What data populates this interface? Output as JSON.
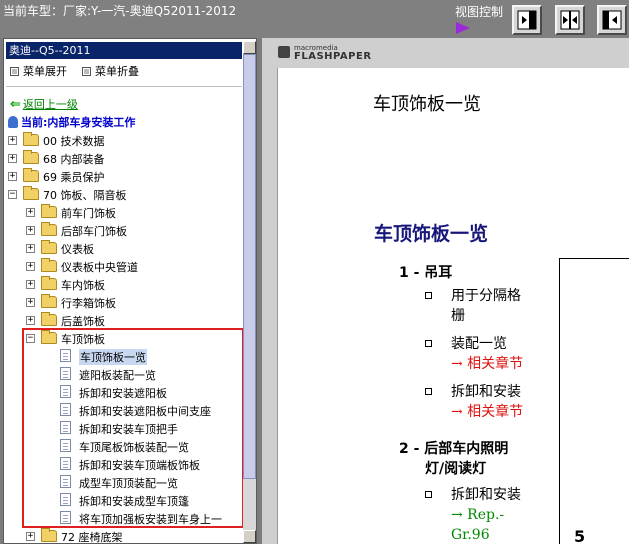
{
  "header": {
    "car_info": "当前车型：厂家:Y-一汽-奥迪Q52011-2012",
    "view_control": "视图控制"
  },
  "tree": {
    "title": "奥迪--Q5--2011",
    "menu_expand": "菜单展开",
    "menu_collapse": "菜单折叠",
    "back_link": "返回上一级",
    "current": "当前:内部车身安装工作",
    "items": [
      {
        "label": "00 技术数据",
        "type": "folder",
        "toggle": "+"
      },
      {
        "label": "68 内部装备",
        "type": "folder",
        "toggle": "+"
      },
      {
        "label": "69 乘员保护",
        "type": "folder",
        "toggle": "+"
      },
      {
        "label": "70 饰板、隔音板",
        "type": "folder",
        "toggle": "-"
      },
      {
        "label": "前车门饰板",
        "type": "folder",
        "toggle": "+"
      },
      {
        "label": "后部车门饰板",
        "type": "folder",
        "toggle": "+"
      },
      {
        "label": "仪表板",
        "type": "folder",
        "toggle": "+"
      },
      {
        "label": "仪表板中央管道",
        "type": "folder",
        "toggle": "+"
      },
      {
        "label": "车内饰板",
        "type": "folder",
        "toggle": "+"
      },
      {
        "label": "行李箱饰板",
        "type": "folder",
        "toggle": "+"
      },
      {
        "label": "后盖饰板",
        "type": "folder",
        "toggle": "+"
      },
      {
        "label": "车顶饰板",
        "type": "folder",
        "toggle": "-"
      },
      {
        "label": "车顶饰板一览",
        "type": "doc",
        "selected": true
      },
      {
        "label": "遮阳板装配一览",
        "type": "doc"
      },
      {
        "label": "拆卸和安装遮阳板",
        "type": "doc"
      },
      {
        "label": "拆卸和安装遮阳板中间支座",
        "type": "doc"
      },
      {
        "label": "拆卸和安装车顶把手",
        "type": "doc"
      },
      {
        "label": "车顶尾板饰板装配一览",
        "type": "doc"
      },
      {
        "label": "拆卸和安装车顶端板饰板",
        "type": "doc"
      },
      {
        "label": "成型车顶顶装配一览",
        "type": "doc"
      },
      {
        "label": "拆卸和安装成型车顶篷",
        "type": "doc"
      },
      {
        "label": "将车顶加强板安装到车身上一",
        "type": "doc"
      },
      {
        "label": "72 座椅底架",
        "type": "folder",
        "toggle": "+"
      }
    ]
  },
  "viewer": {
    "logo_small": "macromedia",
    "logo_big": "FLASHPAPER",
    "page_header": "车顶饰板一览",
    "doc_title": "车顶饰板一览",
    "section1": "1 - 吊耳",
    "s1_b1_line1": "用于分隔格",
    "s1_b1_line2": "栅",
    "s1_b2_line1": "装配一览",
    "s1_b2_ref": "→ 相关章节",
    "s1_b3_line1": "拆卸和安装",
    "s1_b3_ref": "→ 相关章节",
    "section2_line1": "2 - 后部车内照明",
    "section2_line2": "灯/阅读灯",
    "s2_b1_line1": "拆卸和安装",
    "s2_b1_ref1": "→ Rep.-",
    "s2_b1_ref2": "Gr.96",
    "figure_num": "5"
  },
  "colors": {
    "title_bar": "#0a246a",
    "highlight_box": "#e02020",
    "doc_title": "#17177a",
    "ref_red": "#e01010",
    "ref_green": "#008a00"
  }
}
